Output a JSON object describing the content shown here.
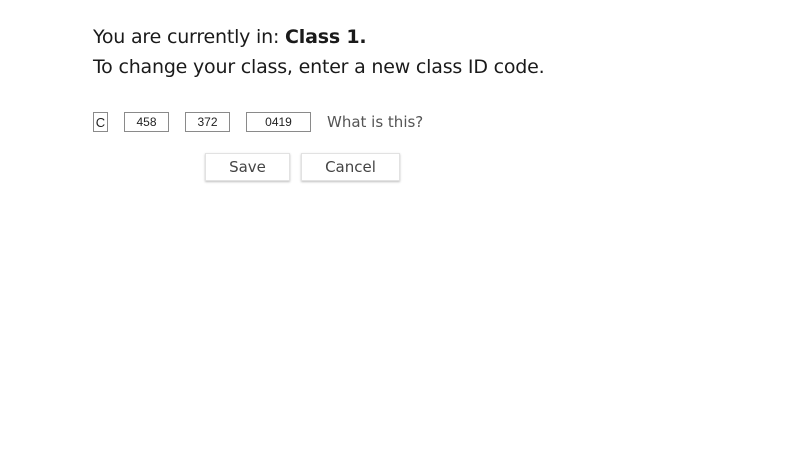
{
  "status": {
    "prefix": "You are currently in: ",
    "class_name": "Class 1."
  },
  "instruction": "To change your class, enter a new class ID code.",
  "class_code": {
    "prefix": "C",
    "part1": "458",
    "part2": "372",
    "part3": "0419"
  },
  "help_link": "What is this?",
  "buttons": {
    "save": "Save",
    "cancel": "Cancel"
  }
}
